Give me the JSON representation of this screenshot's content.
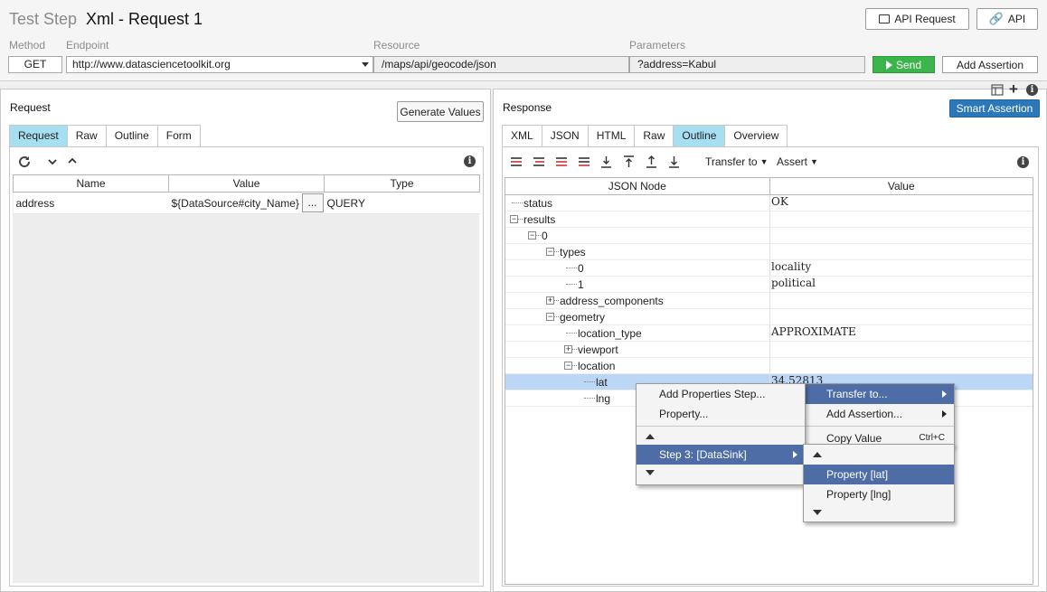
{
  "header": {
    "title_prefix": "Test Step",
    "title": "Xml - Request 1",
    "api_request_label": "API Request",
    "api_label": "API"
  },
  "fields": {
    "method_label": "Method",
    "method_value": "GET",
    "endpoint_label": "Endpoint",
    "endpoint_value": "http://www.datasciencetoolkit.org",
    "resource_label": "Resource",
    "resource_value": "/maps/api/geocode/json",
    "parameters_label": "Parameters",
    "parameters_value": "?address=Kabul",
    "send_label": "Send",
    "add_assertion_label": "Add Assertion"
  },
  "request": {
    "title": "Request",
    "generate_values_label": "Generate Values",
    "tabs": [
      "Request",
      "Raw",
      "Outline",
      "Form"
    ],
    "active_tab": "Request",
    "columns": [
      "Name",
      "Value",
      "Type"
    ],
    "rows": [
      {
        "name": "address",
        "value": "${DataSource#city_Name}",
        "button": "...",
        "type": "QUERY"
      }
    ]
  },
  "response": {
    "title": "Response",
    "smart_assertion_label": "Smart Assertion",
    "tabs": [
      "XML",
      "JSON",
      "HTML",
      "Raw",
      "Outline",
      "Overview"
    ],
    "active_tab": "Outline",
    "transfer_to_label": "Transfer to",
    "assert_label": "Assert",
    "columns": [
      "JSON Node",
      "Value"
    ],
    "tree": [
      {
        "label": "status",
        "value": "OK",
        "depth": 0,
        "expander": ""
      },
      {
        "label": "results",
        "value": "",
        "depth": 0,
        "expander": "minus"
      },
      {
        "label": "0",
        "value": "",
        "depth": 1,
        "expander": "minus"
      },
      {
        "label": "types",
        "value": "",
        "depth": 2,
        "expander": "minus"
      },
      {
        "label": "0",
        "value": "locality",
        "depth": 3,
        "expander": ""
      },
      {
        "label": "1",
        "value": "political",
        "depth": 3,
        "expander": ""
      },
      {
        "label": "address_components",
        "value": "",
        "depth": 2,
        "expander": "plus"
      },
      {
        "label": "geometry",
        "value": "",
        "depth": 2,
        "expander": "minus"
      },
      {
        "label": "location_type",
        "value": "APPROXIMATE",
        "depth": 3,
        "expander": ""
      },
      {
        "label": "viewport",
        "value": "",
        "depth": 3,
        "expander": "plus"
      },
      {
        "label": "location",
        "value": "",
        "depth": 3,
        "expander": "minus"
      },
      {
        "label": "lat",
        "value": "34.52813",
        "depth": 4,
        "expander": "",
        "selected": true
      },
      {
        "label": "lng",
        "value": "",
        "depth": 4,
        "expander": ""
      }
    ]
  },
  "context_menu": {
    "items": [
      "Transfer to...",
      "Add Assertion...",
      "Copy Value"
    ],
    "copy_shortcut": "Ctrl+C"
  },
  "transfer_menu": {
    "items": [
      "Add Properties Step...",
      "Property...",
      "Step 3: [DataSink]"
    ]
  },
  "property_menu": {
    "items": [
      "Property [lat]",
      "Property [lng]"
    ]
  },
  "colors": {
    "active_tab": "#a7dff2",
    "send_green": "#3bb54a",
    "smart_assertion_blue": "#2b78b8",
    "menu_highlight": "#4e6da6",
    "selected_row": "#bcd6f5"
  }
}
